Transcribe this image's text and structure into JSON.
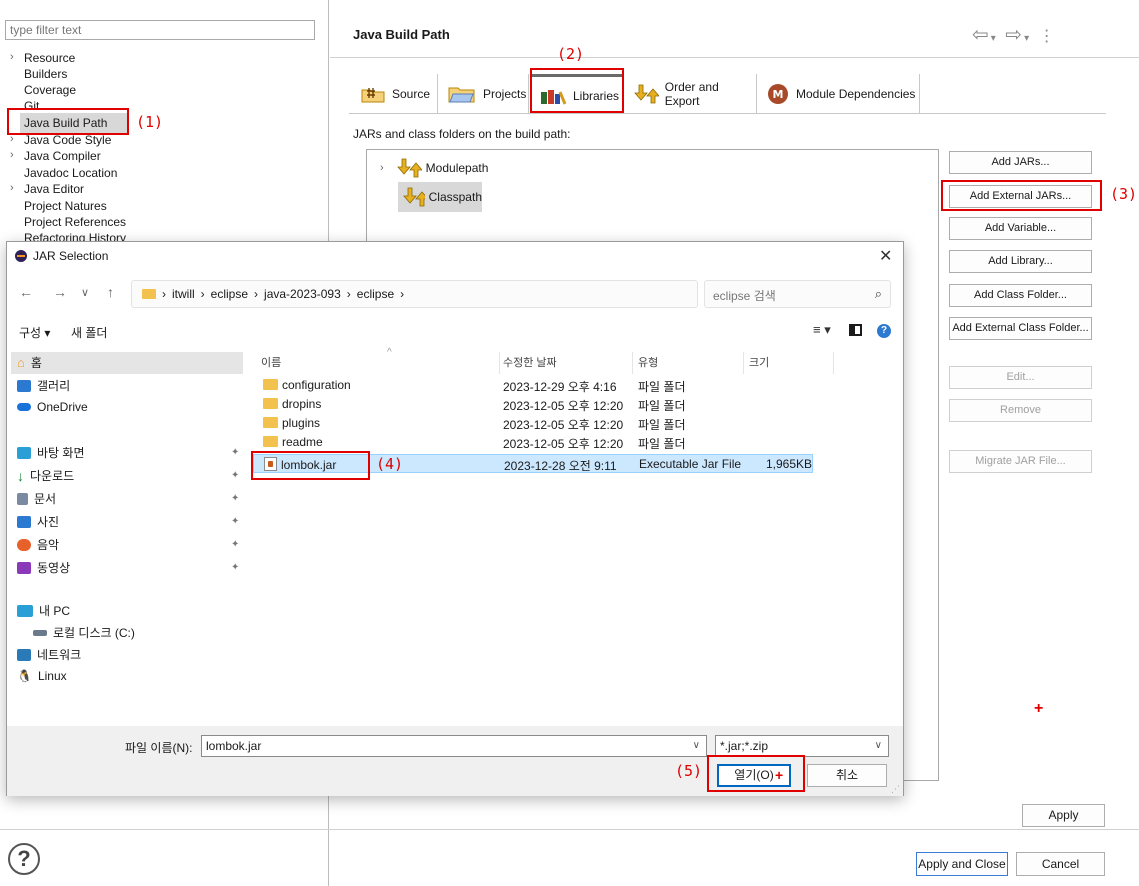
{
  "left_pane": {
    "filter_placeholder": "type filter text",
    "tree": [
      {
        "label": "Resource",
        "expandable": true
      },
      {
        "label": "Builders",
        "expandable": false
      },
      {
        "label": "Coverage",
        "expandable": false
      },
      {
        "label": "Git",
        "expandable": false
      },
      {
        "label": "Java Build Path",
        "expandable": false,
        "selected": true
      },
      {
        "label": "Java Code Style",
        "expandable": true
      },
      {
        "label": "Java Compiler",
        "expandable": true
      },
      {
        "label": "Javadoc Location",
        "expandable": false
      },
      {
        "label": "Java Editor",
        "expandable": true
      },
      {
        "label": "Project Natures",
        "expandable": false
      },
      {
        "label": "Project References",
        "expandable": false
      },
      {
        "label": "Refactoring History",
        "expandable": false
      }
    ]
  },
  "page": {
    "title": "Java Build Path",
    "tabs": [
      "Source",
      "Projects",
      "Libraries",
      "Order and Export",
      "Module Dependencies"
    ],
    "active_tab": "Libraries",
    "list_caption": "JARs and class folders on the build path:",
    "entries": [
      "Modulepath",
      "Classpath"
    ]
  },
  "side_buttons": [
    {
      "label": "Add JARs...",
      "enabled": true
    },
    {
      "label": "Add External JARs...",
      "enabled": true
    },
    {
      "label": "Add Variable...",
      "enabled": true
    },
    {
      "label": "Add Library...",
      "enabled": true
    },
    {
      "label": "Add Class Folder...",
      "enabled": true
    },
    {
      "label": "Add External Class Folder...",
      "enabled": true
    },
    {
      "label": "Edit...",
      "enabled": false
    },
    {
      "label": "Remove",
      "enabled": false
    },
    {
      "label": "Migrate JAR File...",
      "enabled": false
    }
  ],
  "bottom": {
    "apply": "Apply",
    "apply_and_close": "Apply and Close",
    "cancel": "Cancel",
    "help": "?"
  },
  "annotations": [
    "(1)",
    "(2)",
    "(3)",
    "(4)",
    "(5)"
  ],
  "dialog": {
    "title": "JAR Selection",
    "close": "✕",
    "breadcrumb": [
      "itwill",
      "eclipse",
      "java-2023-093",
      "eclipse"
    ],
    "search_placeholder": "eclipse 검색",
    "toolbar": {
      "organize": "구성 ▾",
      "new_folder": "새 폴더"
    },
    "sidebar": {
      "home": "홈",
      "gallery": "갤러리",
      "onedrive": "OneDrive",
      "desktop": "바탕 화면",
      "downloads": "다운로드",
      "documents": "문서",
      "pictures": "사진",
      "music": "음악",
      "videos": "동영상",
      "this_pc": "내 PC",
      "local_disk": "로컬 디스크 (C:)",
      "network": "네트워크",
      "linux": "Linux"
    },
    "columns": {
      "name": "이름",
      "modified": "수정한 날짜",
      "type": "유형",
      "size": "크기"
    },
    "files": [
      {
        "name": "configuration",
        "modified": "2023-12-29 오후 4:16",
        "type": "파일 폴더",
        "size": "",
        "kind": "folder"
      },
      {
        "name": "dropins",
        "modified": "2023-12-05 오후 12:20",
        "type": "파일 폴더",
        "size": "",
        "kind": "folder"
      },
      {
        "name": "plugins",
        "modified": "2023-12-05 오후 12:20",
        "type": "파일 폴더",
        "size": "",
        "kind": "folder"
      },
      {
        "name": "readme",
        "modified": "2023-12-05 오후 12:20",
        "type": "파일 폴더",
        "size": "",
        "kind": "folder"
      },
      {
        "name": "lombok.jar",
        "modified": "2023-12-28 오전 9:11",
        "type": "Executable Jar File",
        "size": "1,965KB",
        "kind": "jar",
        "selected": true
      }
    ],
    "filename_label": "파일 이름(N):",
    "filename_value": "lombok.jar",
    "filetype": "*.jar;*.zip",
    "open": "열기(O)",
    "cancel": "취소"
  },
  "colors": {
    "annotation": "#e00000",
    "selection": "#cce8ff",
    "accent": "#0067c0"
  }
}
